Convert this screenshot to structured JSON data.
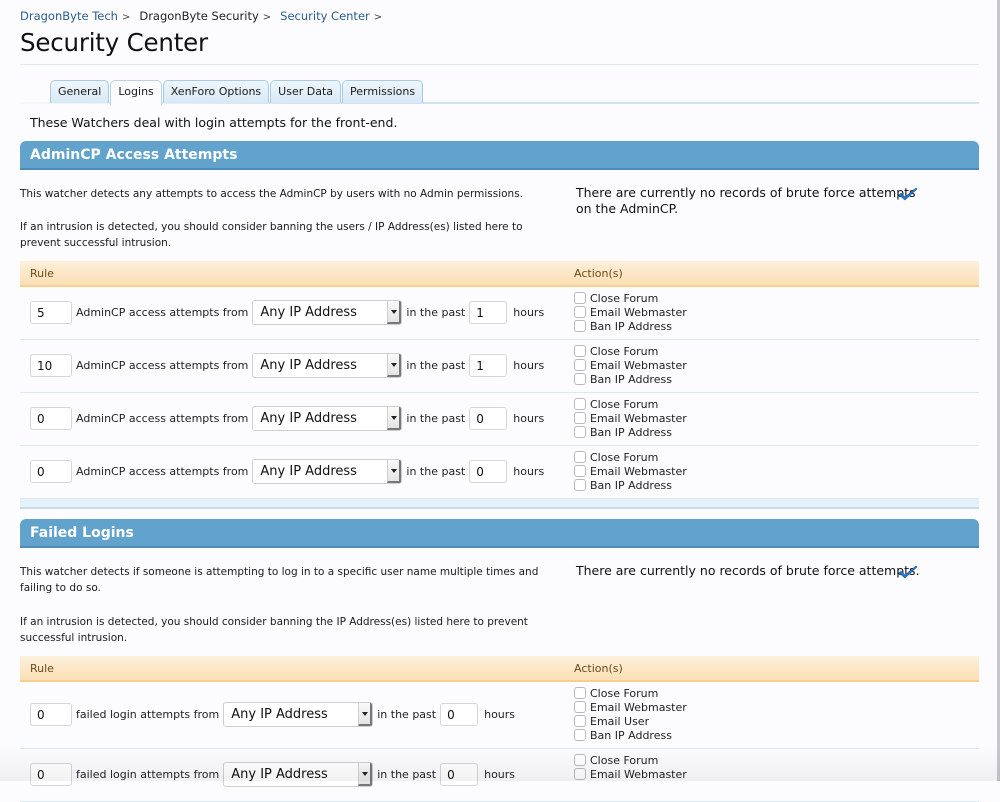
{
  "breadcrumb": [
    {
      "label": "DragonByte Tech",
      "sep": ">"
    },
    {
      "label": "DragonByte Security",
      "sep": ">"
    },
    {
      "label": "Security Center",
      "sep": ">"
    }
  ],
  "page_title": "Security Center",
  "tabs": [
    {
      "label": "General",
      "active": false
    },
    {
      "label": "Logins",
      "active": true
    },
    {
      "label": "XenForo Options",
      "active": false
    },
    {
      "label": "User Data",
      "active": false
    },
    {
      "label": "Permissions",
      "active": false
    }
  ],
  "intro": "These Watchers deal with login attempts for the front-end.",
  "colors": {
    "section_header": "#62a3ce",
    "table_header": "#fbdfb4",
    "link": "#2b5d8c",
    "check": "#2a78c9"
  },
  "sections": [
    {
      "title": "AdminCP Access Attempts",
      "desc1": "This watcher detects any attempts to access the AdminCP by users with no Admin permissions.",
      "desc2": "If an intrusion is detected, you should consider banning the users / IP Address(es) listed here to prevent successful intrusion.",
      "status": "There are currently no records of brute force attempts on the AdminCP.",
      "status_icon": "check-icon",
      "col_rule": "Rule",
      "col_actions": "Action(s)",
      "rows": [
        {
          "count": "5",
          "text": "AdminCP access attempts from",
          "ip": "Any IP Address",
          "past": "in the past",
          "hours": "1",
          "unit": "hours",
          "actions": [
            {
              "label": "Close Forum",
              "checked": false
            },
            {
              "label": "Email Webmaster",
              "checked": false
            },
            {
              "label": "Ban IP Address",
              "checked": false
            }
          ]
        },
        {
          "count": "10",
          "text": "AdminCP access attempts from",
          "ip": "Any IP Address",
          "past": "in the past",
          "hours": "1",
          "unit": "hours",
          "actions": [
            {
              "label": "Close Forum",
              "checked": false
            },
            {
              "label": "Email Webmaster",
              "checked": false
            },
            {
              "label": "Ban IP Address",
              "checked": false
            }
          ]
        },
        {
          "count": "0",
          "text": "AdminCP access attempts from",
          "ip": "Any IP Address",
          "past": "in the past",
          "hours": "0",
          "unit": "hours",
          "actions": [
            {
              "label": "Close Forum",
              "checked": false
            },
            {
              "label": "Email Webmaster",
              "checked": false
            },
            {
              "label": "Ban IP Address",
              "checked": false
            }
          ]
        },
        {
          "count": "0",
          "text": "AdminCP access attempts from",
          "ip": "Any IP Address",
          "past": "in the past",
          "hours": "0",
          "unit": "hours",
          "actions": [
            {
              "label": "Close Forum",
              "checked": false
            },
            {
              "label": "Email Webmaster",
              "checked": false
            },
            {
              "label": "Ban IP Address",
              "checked": false
            }
          ]
        }
      ]
    },
    {
      "title": "Failed Logins",
      "desc1": "This watcher detects if someone is attempting to log in to a specific user name multiple times and failing to do so.",
      "desc2": "If an intrusion is detected, you should consider banning the IP Address(es) listed here to prevent successful intrusion.",
      "status": "There are currently no records of brute force attempts.",
      "status_icon": "check-icon",
      "col_rule": "Rule",
      "col_actions": "Action(s)",
      "rows": [
        {
          "count": "0",
          "text": "failed login attempts from",
          "ip": "Any IP Address",
          "past": "in the past",
          "hours": "0",
          "unit": "hours",
          "actions": [
            {
              "label": "Close Forum",
              "checked": false
            },
            {
              "label": "Email Webmaster",
              "checked": false
            },
            {
              "label": "Email User",
              "checked": false
            },
            {
              "label": "Ban IP Address",
              "checked": false
            }
          ]
        },
        {
          "count": "0",
          "text": "failed login attempts from",
          "ip": "Any IP Address",
          "past": "in the past",
          "hours": "0",
          "unit": "hours",
          "actions": [
            {
              "label": "Close Forum",
              "checked": false
            },
            {
              "label": "Email Webmaster",
              "checked": false
            }
          ]
        }
      ]
    }
  ]
}
